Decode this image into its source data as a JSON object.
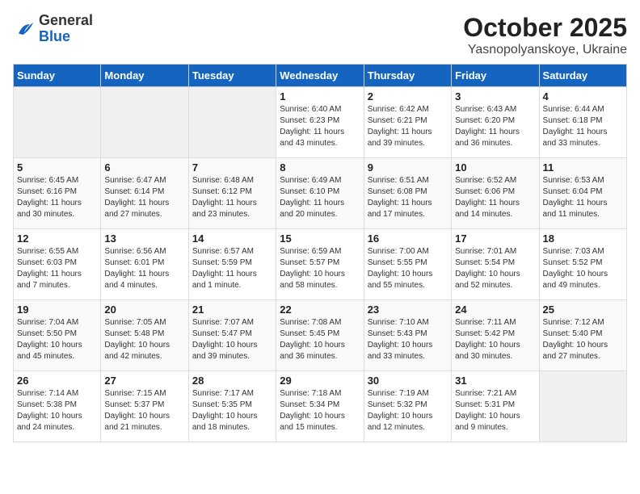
{
  "header": {
    "logo_general": "General",
    "logo_blue": "Blue",
    "title": "October 2025",
    "subtitle": "Yasnopolyanskoye, Ukraine"
  },
  "days_of_week": [
    "Sunday",
    "Monday",
    "Tuesday",
    "Wednesday",
    "Thursday",
    "Friday",
    "Saturday"
  ],
  "weeks": [
    [
      {
        "day": "",
        "info": ""
      },
      {
        "day": "",
        "info": ""
      },
      {
        "day": "",
        "info": ""
      },
      {
        "day": "1",
        "info": "Sunrise: 6:40 AM\nSunset: 6:23 PM\nDaylight: 11 hours\nand 43 minutes."
      },
      {
        "day": "2",
        "info": "Sunrise: 6:42 AM\nSunset: 6:21 PM\nDaylight: 11 hours\nand 39 minutes."
      },
      {
        "day": "3",
        "info": "Sunrise: 6:43 AM\nSunset: 6:20 PM\nDaylight: 11 hours\nand 36 minutes."
      },
      {
        "day": "4",
        "info": "Sunrise: 6:44 AM\nSunset: 6:18 PM\nDaylight: 11 hours\nand 33 minutes."
      }
    ],
    [
      {
        "day": "5",
        "info": "Sunrise: 6:45 AM\nSunset: 6:16 PM\nDaylight: 11 hours\nand 30 minutes."
      },
      {
        "day": "6",
        "info": "Sunrise: 6:47 AM\nSunset: 6:14 PM\nDaylight: 11 hours\nand 27 minutes."
      },
      {
        "day": "7",
        "info": "Sunrise: 6:48 AM\nSunset: 6:12 PM\nDaylight: 11 hours\nand 23 minutes."
      },
      {
        "day": "8",
        "info": "Sunrise: 6:49 AM\nSunset: 6:10 PM\nDaylight: 11 hours\nand 20 minutes."
      },
      {
        "day": "9",
        "info": "Sunrise: 6:51 AM\nSunset: 6:08 PM\nDaylight: 11 hours\nand 17 minutes."
      },
      {
        "day": "10",
        "info": "Sunrise: 6:52 AM\nSunset: 6:06 PM\nDaylight: 11 hours\nand 14 minutes."
      },
      {
        "day": "11",
        "info": "Sunrise: 6:53 AM\nSunset: 6:04 PM\nDaylight: 11 hours\nand 11 minutes."
      }
    ],
    [
      {
        "day": "12",
        "info": "Sunrise: 6:55 AM\nSunset: 6:03 PM\nDaylight: 11 hours\nand 7 minutes."
      },
      {
        "day": "13",
        "info": "Sunrise: 6:56 AM\nSunset: 6:01 PM\nDaylight: 11 hours\nand 4 minutes."
      },
      {
        "day": "14",
        "info": "Sunrise: 6:57 AM\nSunset: 5:59 PM\nDaylight: 11 hours\nand 1 minute."
      },
      {
        "day": "15",
        "info": "Sunrise: 6:59 AM\nSunset: 5:57 PM\nDaylight: 10 hours\nand 58 minutes."
      },
      {
        "day": "16",
        "info": "Sunrise: 7:00 AM\nSunset: 5:55 PM\nDaylight: 10 hours\nand 55 minutes."
      },
      {
        "day": "17",
        "info": "Sunrise: 7:01 AM\nSunset: 5:54 PM\nDaylight: 10 hours\nand 52 minutes."
      },
      {
        "day": "18",
        "info": "Sunrise: 7:03 AM\nSunset: 5:52 PM\nDaylight: 10 hours\nand 49 minutes."
      }
    ],
    [
      {
        "day": "19",
        "info": "Sunrise: 7:04 AM\nSunset: 5:50 PM\nDaylight: 10 hours\nand 45 minutes."
      },
      {
        "day": "20",
        "info": "Sunrise: 7:05 AM\nSunset: 5:48 PM\nDaylight: 10 hours\nand 42 minutes."
      },
      {
        "day": "21",
        "info": "Sunrise: 7:07 AM\nSunset: 5:47 PM\nDaylight: 10 hours\nand 39 minutes."
      },
      {
        "day": "22",
        "info": "Sunrise: 7:08 AM\nSunset: 5:45 PM\nDaylight: 10 hours\nand 36 minutes."
      },
      {
        "day": "23",
        "info": "Sunrise: 7:10 AM\nSunset: 5:43 PM\nDaylight: 10 hours\nand 33 minutes."
      },
      {
        "day": "24",
        "info": "Sunrise: 7:11 AM\nSunset: 5:42 PM\nDaylight: 10 hours\nand 30 minutes."
      },
      {
        "day": "25",
        "info": "Sunrise: 7:12 AM\nSunset: 5:40 PM\nDaylight: 10 hours\nand 27 minutes."
      }
    ],
    [
      {
        "day": "26",
        "info": "Sunrise: 7:14 AM\nSunset: 5:38 PM\nDaylight: 10 hours\nand 24 minutes."
      },
      {
        "day": "27",
        "info": "Sunrise: 7:15 AM\nSunset: 5:37 PM\nDaylight: 10 hours\nand 21 minutes."
      },
      {
        "day": "28",
        "info": "Sunrise: 7:17 AM\nSunset: 5:35 PM\nDaylight: 10 hours\nand 18 minutes."
      },
      {
        "day": "29",
        "info": "Sunrise: 7:18 AM\nSunset: 5:34 PM\nDaylight: 10 hours\nand 15 minutes."
      },
      {
        "day": "30",
        "info": "Sunrise: 7:19 AM\nSunset: 5:32 PM\nDaylight: 10 hours\nand 12 minutes."
      },
      {
        "day": "31",
        "info": "Sunrise: 7:21 AM\nSunset: 5:31 PM\nDaylight: 10 hours\nand 9 minutes."
      },
      {
        "day": "",
        "info": ""
      }
    ]
  ]
}
